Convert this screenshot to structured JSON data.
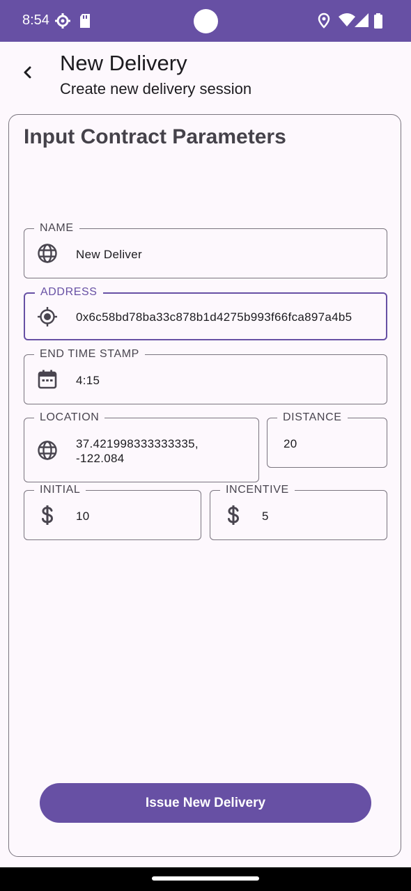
{
  "status_bar": {
    "time": "8:54"
  },
  "header": {
    "title": "New Delivery",
    "subtitle": "Create new delivery session"
  },
  "card": {
    "title": "Input Contract Parameters"
  },
  "fields": {
    "name": {
      "label": "NAME",
      "value": "New Deliver",
      "icon": "globe-icon"
    },
    "address": {
      "label": "ADDRESS",
      "value": "0x6c58bd78ba33c878b1d4275b993f66fca897a4b5",
      "icon": "gps-target-icon"
    },
    "end_time": {
      "label": "END TIME STAMP",
      "value": "4:15",
      "icon": "calendar-icon"
    },
    "location": {
      "label": "LOCATION",
      "value_line1": "37.421998333333335,",
      "value_line2": "-122.084",
      "icon": "globe-icon"
    },
    "distance": {
      "label": "DISTANCE",
      "value": "20"
    },
    "initial": {
      "label": "INITIAL",
      "value": "10",
      "icon": "dollar-icon"
    },
    "incentive": {
      "label": "INCENTIVE",
      "value": "5",
      "icon": "dollar-icon"
    }
  },
  "action": {
    "issue_label": "Issue New Delivery"
  },
  "colors": {
    "primary": "#6750a4",
    "outline": "#79747e",
    "background": "#fdf8fd"
  }
}
